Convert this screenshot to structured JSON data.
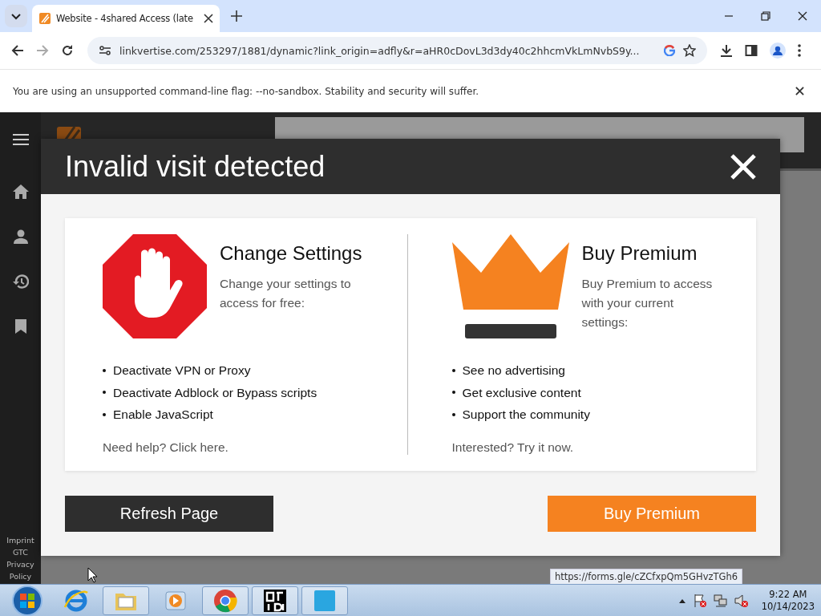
{
  "browser": {
    "tab": {
      "title": "Website - 4shared Access (late",
      "selected": true
    },
    "address": "linkvertise.com/253297/1881/dynamic?link_origin=adfly&r=aHR0cDovL3d3dy40c2hhcmVkLmNvbS9y...",
    "infobar": {
      "message": "You are using an unsupported command-line flag: --no-sandbox. Stability and security will suffer."
    }
  },
  "sidebar": {
    "footer_links": [
      "Imprint",
      "GTC",
      "Privacy Policy"
    ]
  },
  "modal": {
    "title": "Invalid visit detected",
    "options": [
      {
        "kind": "stop",
        "title": "Change Settings",
        "description": "Change your settings to access for free:",
        "bullets": [
          "Deactivate VPN or Proxy",
          "Deactivate Adblock or Bypass scripts",
          "Enable JavaScript"
        ],
        "link": "Need help? Click here."
      },
      {
        "kind": "crown",
        "title": "Buy Premium",
        "description": "Buy Premium to access with your current settings:",
        "bullets": [
          "See no advertising",
          "Get exclusive content",
          "Support the community"
        ],
        "link": "Interested? Try it now."
      }
    ],
    "buttons": [
      {
        "label": "Refresh Page",
        "kind": "secondary"
      },
      {
        "label": "Buy Premium",
        "kind": "primary"
      }
    ]
  },
  "status_url": "https://forms.gle/cZCfxpQm5GHvzTGh6",
  "taskbar": {
    "time": "9:22 AM",
    "date": "10/14/2023"
  }
}
